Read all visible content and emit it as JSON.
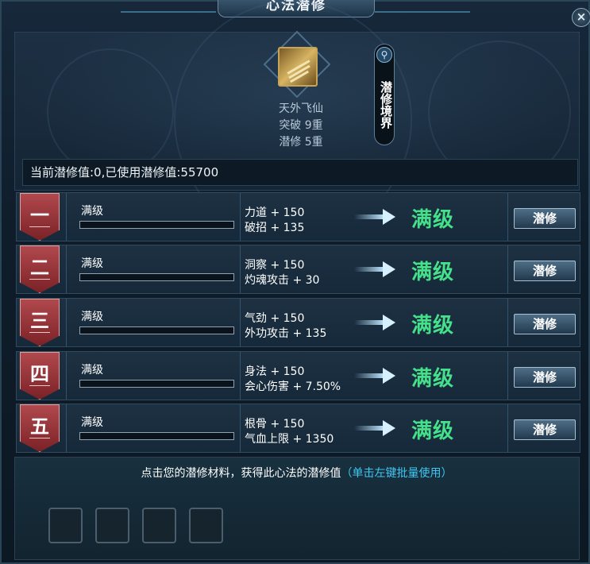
{
  "window": {
    "title": "心法潜修",
    "close_label": "×"
  },
  "skill": {
    "icon_name": "book-icon",
    "name": "天外飞仙",
    "breakthrough": "突破 9重",
    "cultivation": "潜修 5重"
  },
  "realm_button": {
    "icon": "search-icon",
    "label": "潜修境界"
  },
  "info": {
    "text": "当前潜修值:0,已使用潜修值:55700"
  },
  "rows": [
    {
      "numeral": "一",
      "status": "满级",
      "stat1": "力道 + 150",
      "stat2": "破招 + 135",
      "result": "满级",
      "button": "潜修"
    },
    {
      "numeral": "二",
      "status": "满级",
      "stat1": "洞察 + 150",
      "stat2": "灼魂攻击 + 30",
      "result": "满级",
      "button": "潜修"
    },
    {
      "numeral": "三",
      "status": "满级",
      "stat1": "气劲 + 150",
      "stat2": "外功攻击 + 135",
      "result": "满级",
      "button": "潜修"
    },
    {
      "numeral": "四",
      "status": "满级",
      "stat1": "身法 + 150",
      "stat2": "会心伤害 + 7.50%",
      "result": "满级",
      "button": "潜修"
    },
    {
      "numeral": "五",
      "status": "满级",
      "stat1": "根骨 + 150",
      "stat2": "气血上限 + 1350",
      "result": "满级",
      "button": "潜修"
    }
  ],
  "bottom": {
    "hint": "点击您的潜修材料，获得此心法的潜修值",
    "hint_link": "（单击左键批量使用）"
  },
  "colors": {
    "max_text": "#45e08a",
    "link": "#3ec7f2",
    "badge": "#9a3439"
  }
}
